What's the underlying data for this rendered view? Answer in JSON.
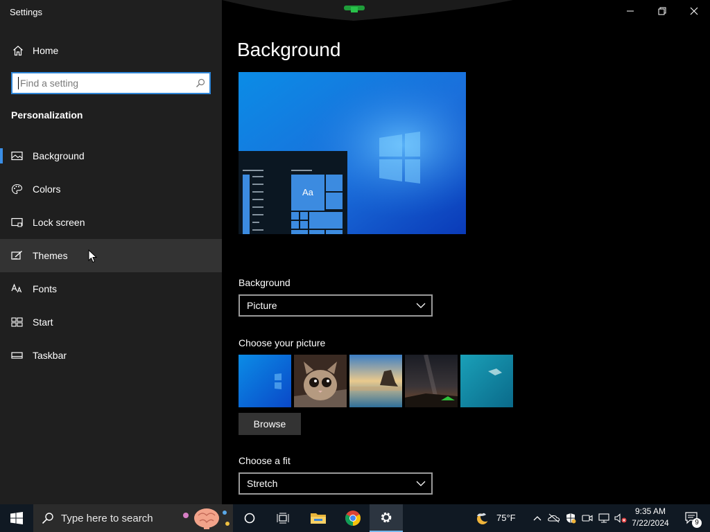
{
  "window": {
    "title": "Settings"
  },
  "sidebar": {
    "home_label": "Home",
    "search_placeholder": "Find a setting",
    "section_title": "Personalization",
    "items": [
      {
        "label": "Background",
        "icon": "picture-icon"
      },
      {
        "label": "Colors",
        "icon": "palette-icon"
      },
      {
        "label": "Lock screen",
        "icon": "lock-screen-icon"
      },
      {
        "label": "Themes",
        "icon": "themes-icon"
      },
      {
        "label": "Fonts",
        "icon": "fonts-icon"
      },
      {
        "label": "Start",
        "icon": "start-icon"
      },
      {
        "label": "Taskbar",
        "icon": "taskbar-icon"
      }
    ]
  },
  "main": {
    "title": "Background",
    "preview_sample_text": "Aa",
    "background_label": "Background",
    "background_value": "Picture",
    "choose_picture_label": "Choose your picture",
    "browse_label": "Browse",
    "fit_label": "Choose a fit",
    "fit_value": "Stretch"
  },
  "taskbar": {
    "search_placeholder": "Type here to search",
    "weather_temp": "75°F",
    "time": "9:35 AM",
    "date": "7/22/2024",
    "notification_count": "9"
  },
  "colors": {
    "accent": "#3a8ee6",
    "sidebar_bg": "#1f1f1f",
    "hover_bg": "#333333",
    "taskbar_bg": "#101923"
  }
}
